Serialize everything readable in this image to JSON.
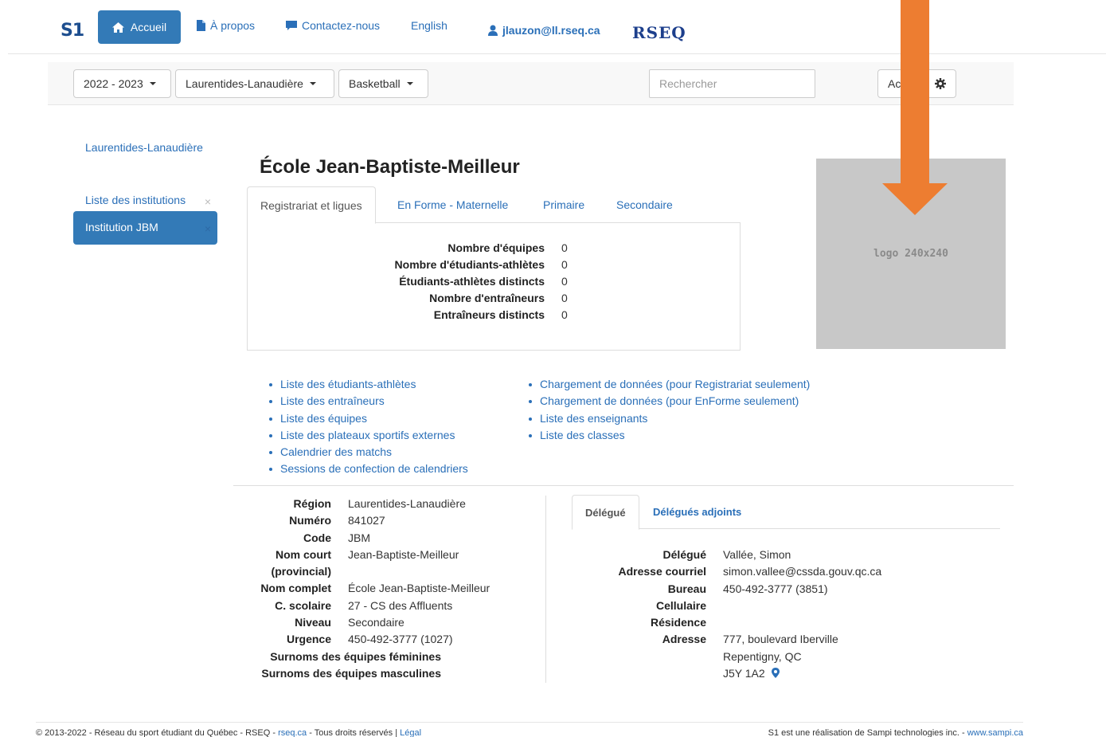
{
  "nav": {
    "brand": "S1",
    "home": "Accueil",
    "about": "À propos",
    "contact": "Contactez-nous",
    "language": "English",
    "user": "jlauzon@ll.rseq.ca",
    "org_logo": "RSEQ"
  },
  "filters": {
    "season": "2022 - 2023",
    "region": "Laurentides-Lanaudière",
    "sport": "Basketball",
    "search_placeholder": "Rechercher",
    "action_label": "Ac"
  },
  "sidebar": {
    "items": [
      {
        "label": "Laurentides-Lanaudière"
      },
      {
        "label": "Liste des institutions",
        "close": "×"
      },
      {
        "label": "Institution JBM",
        "close": "×"
      }
    ]
  },
  "main": {
    "title": "École Jean-Baptiste-Meilleur",
    "tabs": [
      {
        "label": "Registrariat et ligues"
      },
      {
        "label": "En Forme - Maternelle"
      },
      {
        "label": "Primaire"
      },
      {
        "label": "Secondaire"
      }
    ],
    "stats": [
      {
        "label": "Nombre d'équipes",
        "value": "0"
      },
      {
        "label": "Nombre d'étudiants-athlètes",
        "value": "0"
      },
      {
        "label": "Étudiants-athlètes distincts",
        "value": "0"
      },
      {
        "label": "Nombre d'entraîneurs",
        "value": "0"
      },
      {
        "label": "Entraîneurs distincts",
        "value": "0"
      }
    ],
    "logo_placeholder": "logo 240x240"
  },
  "links_left": [
    "Liste des étudiants-athlètes",
    "Liste des entraîneurs",
    "Liste des équipes",
    "Liste des plateaux sportifs externes",
    "Calendrier des matchs",
    "Sessions de confection de calendriers"
  ],
  "links_right": [
    "Chargement de données (pour Registrariat seulement)",
    "Chargement de données (pour EnForme seulement)",
    "Liste des enseignants",
    "Liste des classes"
  ],
  "institution": {
    "rows": [
      {
        "label": "Région",
        "value": "Laurentides-Lanaudière"
      },
      {
        "label": "Numéro",
        "value": "841027"
      },
      {
        "label": "Code",
        "value": "JBM"
      },
      {
        "label": "Nom court",
        "value": "Jean-Baptiste-Meilleur"
      },
      {
        "label": "(provincial)",
        "value": ""
      },
      {
        "label": "Nom complet",
        "value": "École Jean-Baptiste-Meilleur"
      },
      {
        "label": "C. scolaire",
        "value": "27 - CS des Affluents"
      },
      {
        "label": "Niveau",
        "value": "Secondaire"
      },
      {
        "label": "Urgence",
        "value": "450-492-3777 (1027)"
      }
    ],
    "nicknames_female": "Surnoms des équipes féminines",
    "nicknames_male": "Surnoms des équipes masculines"
  },
  "delegate": {
    "tabs": [
      {
        "label": "Délégué"
      },
      {
        "label": "Délégués adjoints"
      }
    ],
    "rows": [
      {
        "label": "Délégué",
        "value": "Vallée, Simon"
      },
      {
        "label": "Adresse courriel",
        "value": "simon.vallee@cssda.gouv.qc.ca"
      },
      {
        "label": "Bureau",
        "value": "450-492-3777 (3851)"
      },
      {
        "label": "Cellulaire",
        "value": ""
      },
      {
        "label": "Résidence",
        "value": ""
      },
      {
        "label": "Adresse",
        "value": "777, boulevard Iberville"
      },
      {
        "label": "",
        "value": "Repentigny, QC"
      },
      {
        "label": "",
        "value": "J5Y 1A2"
      }
    ]
  },
  "footer": {
    "left_text": "© 2013-2022 - Réseau du sport étudiant du Québec - RSEQ - ",
    "left_link": "rseq.ca",
    "left_text2": " - Tous droits réservés | ",
    "legal": "Légal",
    "right_text": "S1 est une réalisation de Sampi technologies inc. - ",
    "right_link": "www.sampi.ca"
  },
  "colors": {
    "primary": "#337ab7",
    "link": "#2a6fb8",
    "annotation_arrow": "#ed7d31"
  }
}
